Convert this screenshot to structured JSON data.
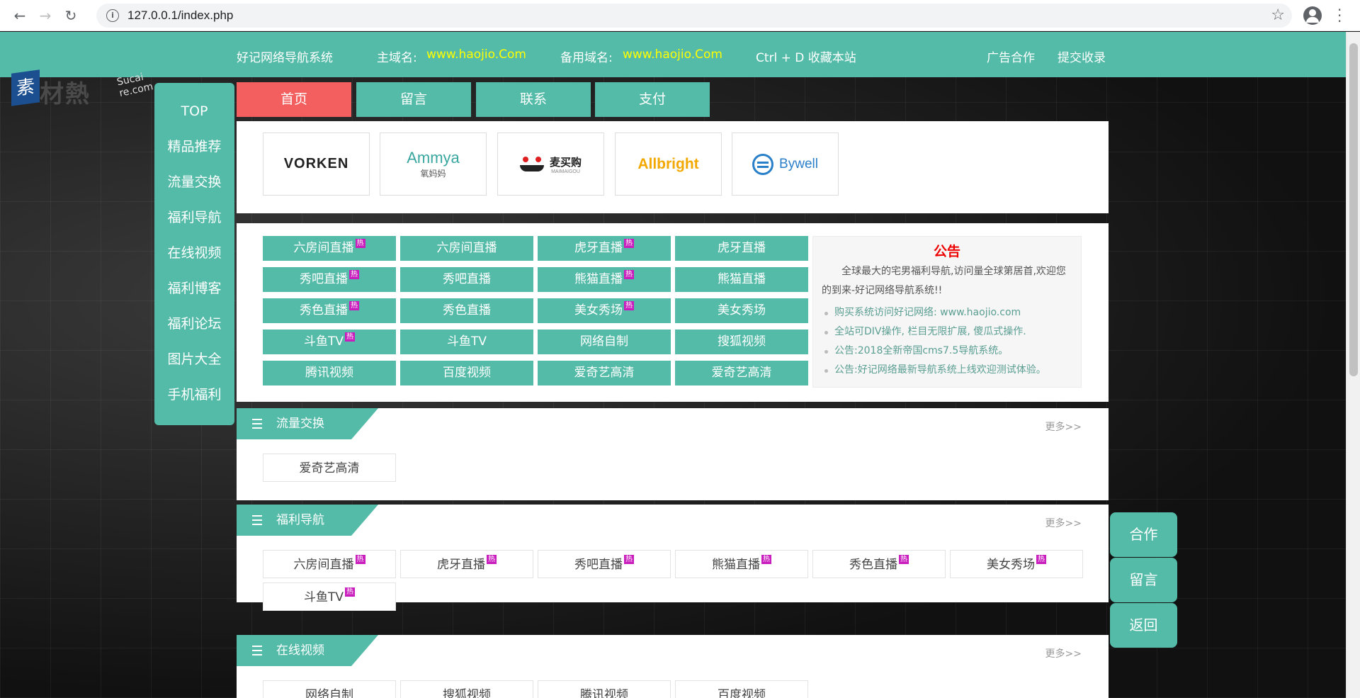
{
  "browser": {
    "url": "127.0.0.1/index.php"
  },
  "watermark": {
    "logo_char": "素",
    "text": "材熱",
    "sub": "Sucai re.com"
  },
  "topbar": {
    "site_name": "好记网络导航系统",
    "main_label": "主域名:",
    "main_domain": "www.haojio.Com",
    "backup_label": "备用域名:",
    "backup_domain": "www.haojio.Com",
    "bookmark": "Ctrl + D 收藏本站",
    "ad": "广告合作",
    "submit": "提交收录"
  },
  "sidebar": [
    "TOP",
    "精品推荐",
    "流量交换",
    "福利导航",
    "在线视频",
    "福利博客",
    "福利论坛",
    "图片大全",
    "手机福利"
  ],
  "tabs": [
    "首页",
    "留言",
    "联系",
    "支付"
  ],
  "logos": [
    "VORKEN",
    "Ammya",
    "麦买购",
    "Allbright",
    "Bywell"
  ],
  "logo_subs": {
    "ammya": "氧妈妈",
    "maimai": "MAIMAIGOU"
  },
  "links": [
    {
      "label": "六房间直播",
      "hot": true
    },
    {
      "label": "六房间直播",
      "hot": false
    },
    {
      "label": "虎牙直播",
      "hot": true
    },
    {
      "label": "虎牙直播",
      "hot": false
    },
    {
      "label": "秀吧直播",
      "hot": true
    },
    {
      "label": "秀吧直播",
      "hot": false
    },
    {
      "label": "熊猫直播",
      "hot": true
    },
    {
      "label": "熊猫直播",
      "hot": false
    },
    {
      "label": "秀色直播",
      "hot": true
    },
    {
      "label": "秀色直播",
      "hot": false
    },
    {
      "label": "美女秀场",
      "hot": true
    },
    {
      "label": "美女秀场",
      "hot": false
    },
    {
      "label": "斗鱼TV",
      "hot": true
    },
    {
      "label": "斗鱼TV",
      "hot": false
    },
    {
      "label": "网络自制",
      "hot": false
    },
    {
      "label": "搜狐视频",
      "hot": false
    },
    {
      "label": "腾讯视频",
      "hot": false
    },
    {
      "label": "百度视频",
      "hot": false
    },
    {
      "label": "爱奇艺高清",
      "hot": false
    },
    {
      "label": "爱奇艺高清",
      "hot": false
    }
  ],
  "hot_text": "热",
  "notice": {
    "title": "公告",
    "body": "全球最大的宅男福利导航,访问量全球第居首,欢迎您的到来-好记网络导航系统!!",
    "items": [
      "购买系统访问好记网络: www.haojio.com",
      "全站可DIV操作, 栏目无限扩展, 傻瓜式操作.",
      "公告:2018全新帝国cms7.5导航系统。",
      "公告:好记网络最新导航系统上线欢迎测试体验。"
    ]
  },
  "sections": [
    {
      "title": "流量交换",
      "more": "更多>>",
      "items": [
        {
          "label": "爱奇艺高清",
          "hot": false
        }
      ]
    },
    {
      "title": "福利导航",
      "more": "更多>>",
      "items": [
        {
          "label": "六房间直播",
          "hot": true
        },
        {
          "label": "虎牙直播",
          "hot": true
        },
        {
          "label": "秀吧直播",
          "hot": true
        },
        {
          "label": "熊猫直播",
          "hot": true
        },
        {
          "label": "秀色直播",
          "hot": true
        },
        {
          "label": "美女秀场",
          "hot": true
        },
        {
          "label": "斗鱼TV",
          "hot": true
        }
      ]
    },
    {
      "title": "在线视频",
      "more": "更多>>",
      "items": [
        {
          "label": "网络自制",
          "hot": false
        },
        {
          "label": "搜狐视频",
          "hot": false
        },
        {
          "label": "腾讯视频",
          "hot": false
        },
        {
          "label": "百度视频",
          "hot": false
        }
      ]
    }
  ],
  "floating": [
    "合作",
    "留言",
    "返回"
  ],
  "colors": {
    "accent": "#53bba7",
    "active_tab": "#f35e5e",
    "hot_badge": "#c91ebd",
    "notice_title": "#ee0000",
    "domain": "#ffff00"
  }
}
